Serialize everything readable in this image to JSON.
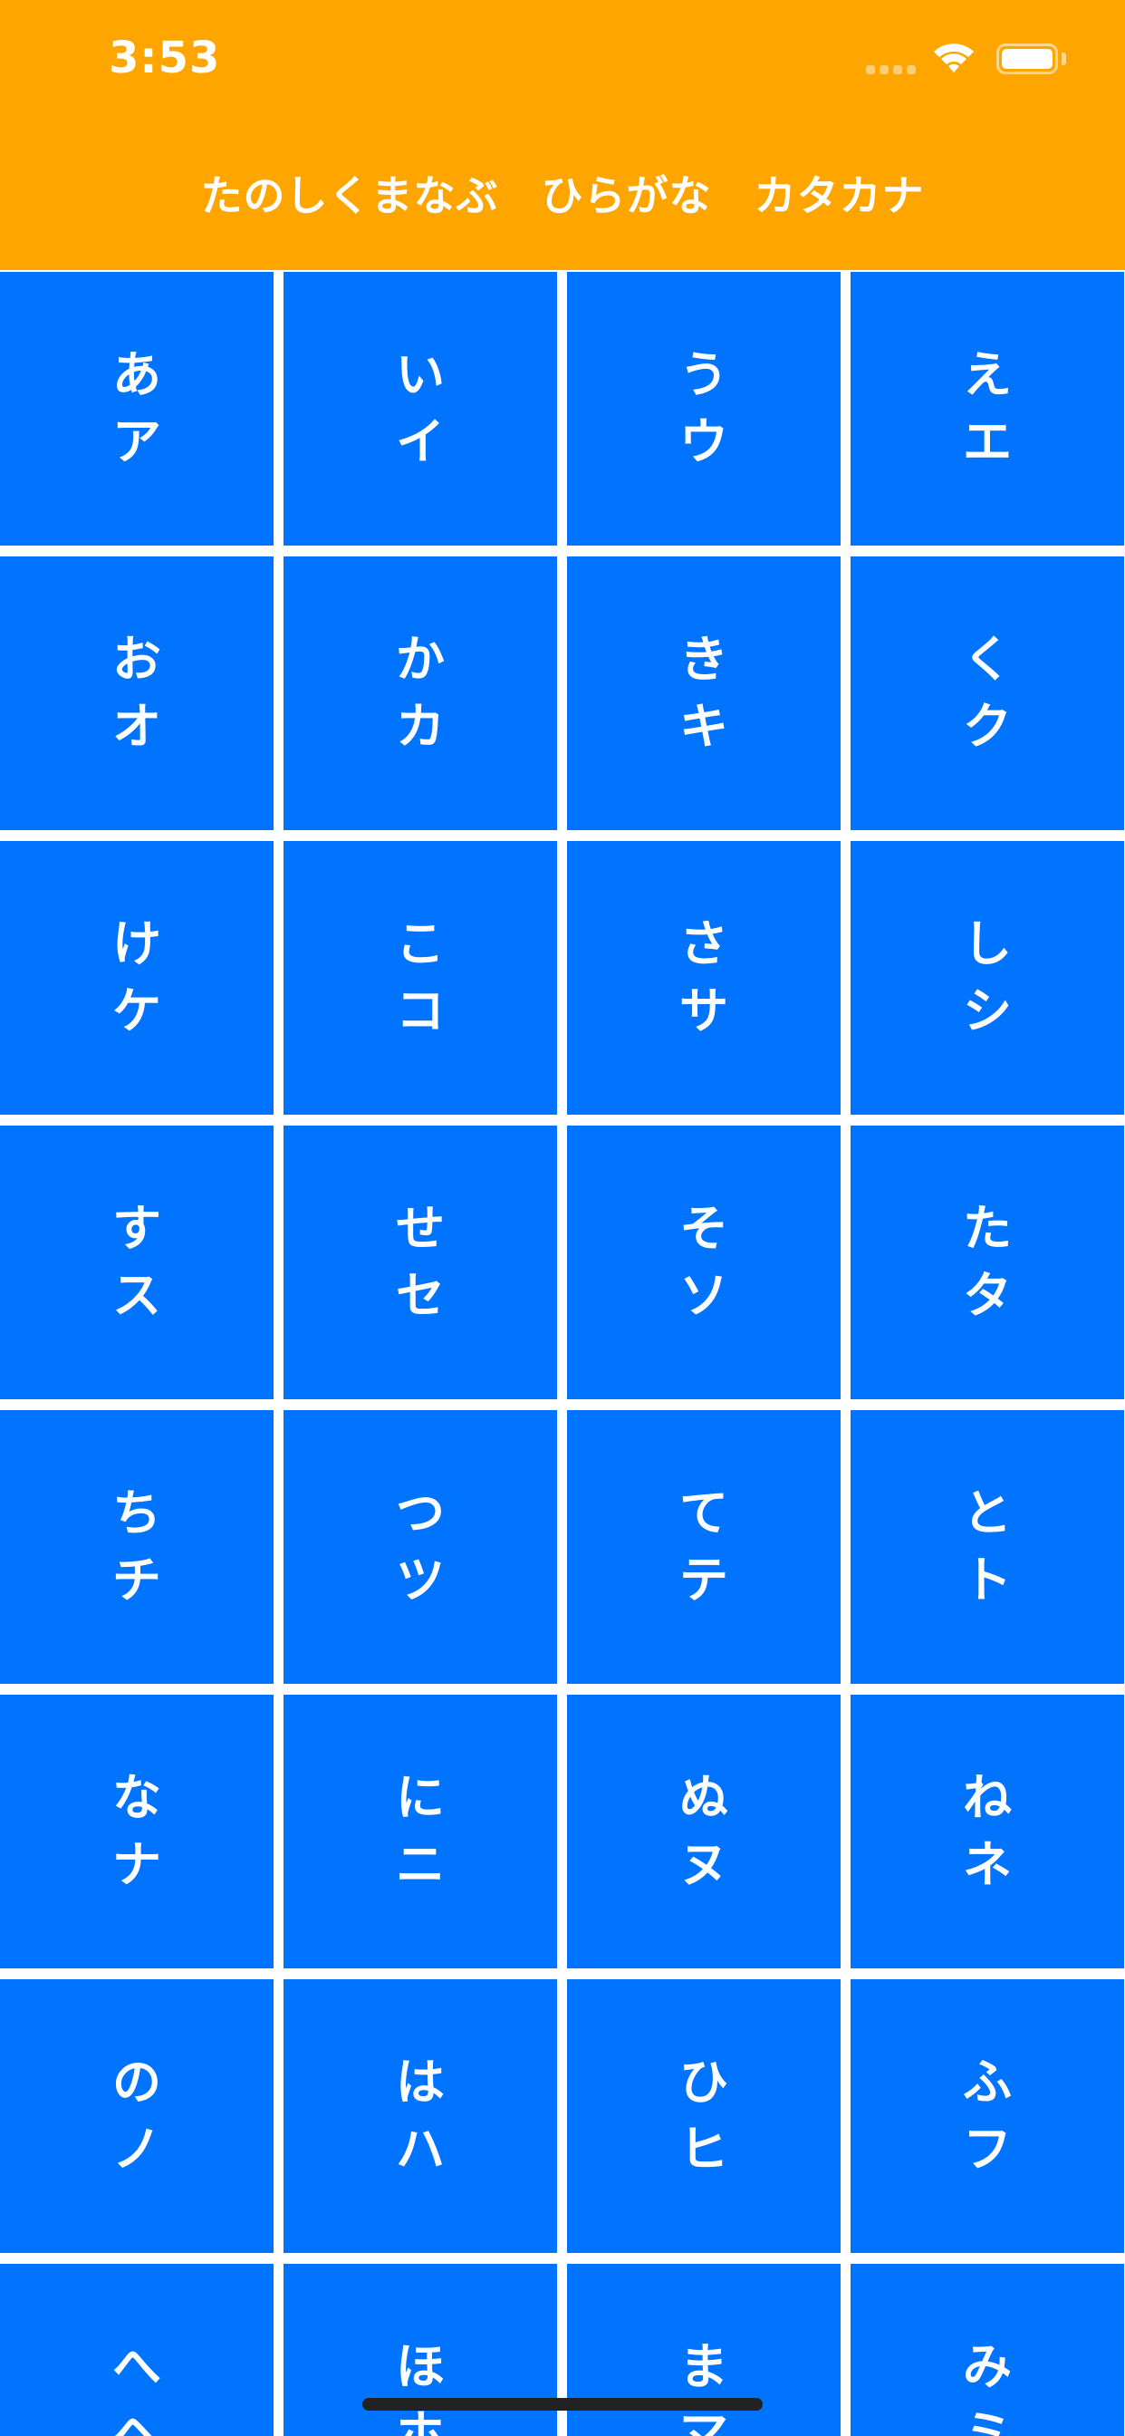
{
  "status_bar": {
    "time": "3:53"
  },
  "header": {
    "title": "たのしくまなぶ　ひらがな　カタカナ",
    "background_color": "#FFA500"
  },
  "grid": {
    "cell_color": "#0073FF",
    "cells": [
      {
        "hiragana": "あ",
        "katakana": "ア"
      },
      {
        "hiragana": "い",
        "katakana": "イ"
      },
      {
        "hiragana": "う",
        "katakana": "ウ"
      },
      {
        "hiragana": "え",
        "katakana": "エ"
      },
      {
        "hiragana": "お",
        "katakana": "オ"
      },
      {
        "hiragana": "か",
        "katakana": "カ"
      },
      {
        "hiragana": "き",
        "katakana": "キ"
      },
      {
        "hiragana": "く",
        "katakana": "ク"
      },
      {
        "hiragana": "け",
        "katakana": "ケ"
      },
      {
        "hiragana": "こ",
        "katakana": "コ"
      },
      {
        "hiragana": "さ",
        "katakana": "サ"
      },
      {
        "hiragana": "し",
        "katakana": "シ"
      },
      {
        "hiragana": "す",
        "katakana": "ス"
      },
      {
        "hiragana": "せ",
        "katakana": "セ"
      },
      {
        "hiragana": "そ",
        "katakana": "ソ"
      },
      {
        "hiragana": "た",
        "katakana": "タ"
      },
      {
        "hiragana": "ち",
        "katakana": "チ"
      },
      {
        "hiragana": "つ",
        "katakana": "ツ"
      },
      {
        "hiragana": "て",
        "katakana": "テ"
      },
      {
        "hiragana": "と",
        "katakana": "ト"
      },
      {
        "hiragana": "な",
        "katakana": "ナ"
      },
      {
        "hiragana": "に",
        "katakana": "ニ"
      },
      {
        "hiragana": "ぬ",
        "katakana": "ヌ"
      },
      {
        "hiragana": "ね",
        "katakana": "ネ"
      },
      {
        "hiragana": "の",
        "katakana": "ノ"
      },
      {
        "hiragana": "は",
        "katakana": "ハ"
      },
      {
        "hiragana": "ひ",
        "katakana": "ヒ"
      },
      {
        "hiragana": "ふ",
        "katakana": "フ"
      },
      {
        "hiragana": "へ",
        "katakana": "ヘ"
      },
      {
        "hiragana": "ほ",
        "katakana": "ホ"
      },
      {
        "hiragana": "ま",
        "katakana": "マ"
      },
      {
        "hiragana": "み",
        "katakana": "ミ"
      }
    ]
  }
}
